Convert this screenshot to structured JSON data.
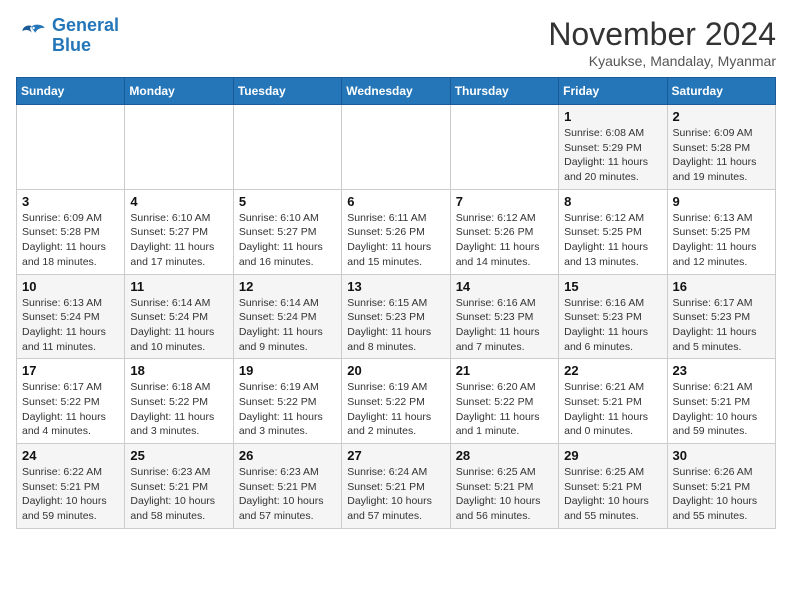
{
  "header": {
    "logo_line1": "General",
    "logo_line2": "Blue",
    "month": "November 2024",
    "location": "Kyaukse, Mandalay, Myanmar"
  },
  "weekdays": [
    "Sunday",
    "Monday",
    "Tuesday",
    "Wednesday",
    "Thursday",
    "Friday",
    "Saturday"
  ],
  "weeks": [
    [
      {
        "num": "",
        "detail": ""
      },
      {
        "num": "",
        "detail": ""
      },
      {
        "num": "",
        "detail": ""
      },
      {
        "num": "",
        "detail": ""
      },
      {
        "num": "",
        "detail": ""
      },
      {
        "num": "1",
        "detail": "Sunrise: 6:08 AM\nSunset: 5:29 PM\nDaylight: 11 hours\nand 20 minutes."
      },
      {
        "num": "2",
        "detail": "Sunrise: 6:09 AM\nSunset: 5:28 PM\nDaylight: 11 hours\nand 19 minutes."
      }
    ],
    [
      {
        "num": "3",
        "detail": "Sunrise: 6:09 AM\nSunset: 5:28 PM\nDaylight: 11 hours\nand 18 minutes."
      },
      {
        "num": "4",
        "detail": "Sunrise: 6:10 AM\nSunset: 5:27 PM\nDaylight: 11 hours\nand 17 minutes."
      },
      {
        "num": "5",
        "detail": "Sunrise: 6:10 AM\nSunset: 5:27 PM\nDaylight: 11 hours\nand 16 minutes."
      },
      {
        "num": "6",
        "detail": "Sunrise: 6:11 AM\nSunset: 5:26 PM\nDaylight: 11 hours\nand 15 minutes."
      },
      {
        "num": "7",
        "detail": "Sunrise: 6:12 AM\nSunset: 5:26 PM\nDaylight: 11 hours\nand 14 minutes."
      },
      {
        "num": "8",
        "detail": "Sunrise: 6:12 AM\nSunset: 5:25 PM\nDaylight: 11 hours\nand 13 minutes."
      },
      {
        "num": "9",
        "detail": "Sunrise: 6:13 AM\nSunset: 5:25 PM\nDaylight: 11 hours\nand 12 minutes."
      }
    ],
    [
      {
        "num": "10",
        "detail": "Sunrise: 6:13 AM\nSunset: 5:24 PM\nDaylight: 11 hours\nand 11 minutes."
      },
      {
        "num": "11",
        "detail": "Sunrise: 6:14 AM\nSunset: 5:24 PM\nDaylight: 11 hours\nand 10 minutes."
      },
      {
        "num": "12",
        "detail": "Sunrise: 6:14 AM\nSunset: 5:24 PM\nDaylight: 11 hours\nand 9 minutes."
      },
      {
        "num": "13",
        "detail": "Sunrise: 6:15 AM\nSunset: 5:23 PM\nDaylight: 11 hours\nand 8 minutes."
      },
      {
        "num": "14",
        "detail": "Sunrise: 6:16 AM\nSunset: 5:23 PM\nDaylight: 11 hours\nand 7 minutes."
      },
      {
        "num": "15",
        "detail": "Sunrise: 6:16 AM\nSunset: 5:23 PM\nDaylight: 11 hours\nand 6 minutes."
      },
      {
        "num": "16",
        "detail": "Sunrise: 6:17 AM\nSunset: 5:23 PM\nDaylight: 11 hours\nand 5 minutes."
      }
    ],
    [
      {
        "num": "17",
        "detail": "Sunrise: 6:17 AM\nSunset: 5:22 PM\nDaylight: 11 hours\nand 4 minutes."
      },
      {
        "num": "18",
        "detail": "Sunrise: 6:18 AM\nSunset: 5:22 PM\nDaylight: 11 hours\nand 3 minutes."
      },
      {
        "num": "19",
        "detail": "Sunrise: 6:19 AM\nSunset: 5:22 PM\nDaylight: 11 hours\nand 3 minutes."
      },
      {
        "num": "20",
        "detail": "Sunrise: 6:19 AM\nSunset: 5:22 PM\nDaylight: 11 hours\nand 2 minutes."
      },
      {
        "num": "21",
        "detail": "Sunrise: 6:20 AM\nSunset: 5:22 PM\nDaylight: 11 hours\nand 1 minute."
      },
      {
        "num": "22",
        "detail": "Sunrise: 6:21 AM\nSunset: 5:21 PM\nDaylight: 11 hours\nand 0 minutes."
      },
      {
        "num": "23",
        "detail": "Sunrise: 6:21 AM\nSunset: 5:21 PM\nDaylight: 10 hours\nand 59 minutes."
      }
    ],
    [
      {
        "num": "24",
        "detail": "Sunrise: 6:22 AM\nSunset: 5:21 PM\nDaylight: 10 hours\nand 59 minutes."
      },
      {
        "num": "25",
        "detail": "Sunrise: 6:23 AM\nSunset: 5:21 PM\nDaylight: 10 hours\nand 58 minutes."
      },
      {
        "num": "26",
        "detail": "Sunrise: 6:23 AM\nSunset: 5:21 PM\nDaylight: 10 hours\nand 57 minutes."
      },
      {
        "num": "27",
        "detail": "Sunrise: 6:24 AM\nSunset: 5:21 PM\nDaylight: 10 hours\nand 57 minutes."
      },
      {
        "num": "28",
        "detail": "Sunrise: 6:25 AM\nSunset: 5:21 PM\nDaylight: 10 hours\nand 56 minutes."
      },
      {
        "num": "29",
        "detail": "Sunrise: 6:25 AM\nSunset: 5:21 PM\nDaylight: 10 hours\nand 55 minutes."
      },
      {
        "num": "30",
        "detail": "Sunrise: 6:26 AM\nSunset: 5:21 PM\nDaylight: 10 hours\nand 55 minutes."
      }
    ]
  ]
}
